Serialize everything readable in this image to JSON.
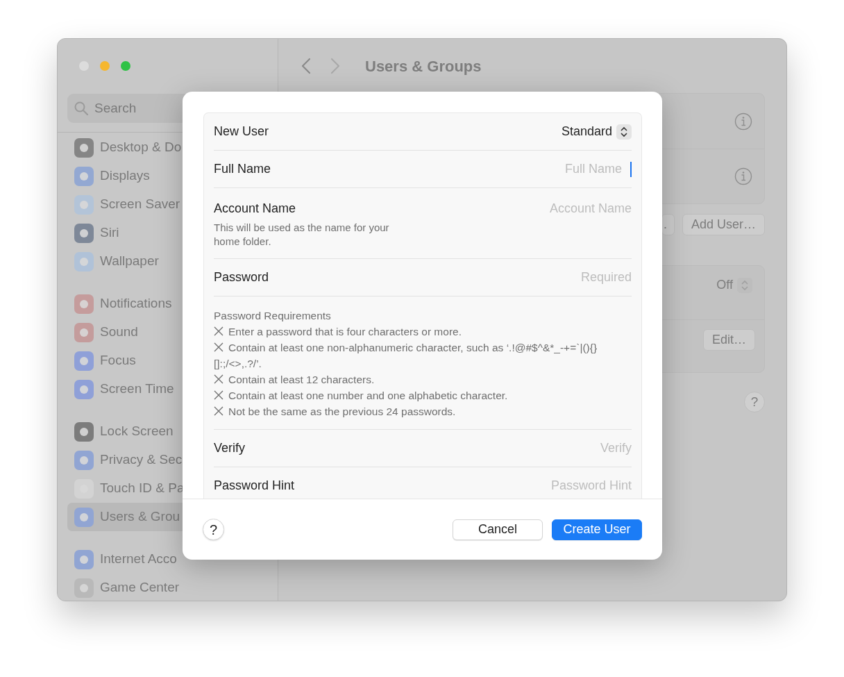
{
  "window": {
    "title": "Users & Groups",
    "controls": [
      {
        "color": "#dcdcdc"
      },
      {
        "color": "#f5b730"
      },
      {
        "color": "#2fc246"
      }
    ]
  },
  "sidebar": {
    "search": {
      "placeholder": "Search"
    },
    "groups": [
      {
        "items": [
          {
            "label": "Desktop & Do",
            "selected": false
          },
          {
            "label": "Displays",
            "selected": false
          },
          {
            "label": "Screen Saver",
            "selected": false
          },
          {
            "label": "Siri",
            "selected": false
          },
          {
            "label": "Wallpaper",
            "selected": false
          }
        ]
      },
      {
        "items": [
          {
            "label": "Notifications",
            "selected": false
          },
          {
            "label": "Sound",
            "selected": false
          },
          {
            "label": "Focus",
            "selected": false
          },
          {
            "label": "Screen Time",
            "selected": false
          }
        ]
      },
      {
        "items": [
          {
            "label": "Lock Screen",
            "selected": false
          },
          {
            "label": "Privacy & Sec",
            "selected": false
          },
          {
            "label": "Touch ID & Pa",
            "selected": false
          },
          {
            "label": "Users & Grou",
            "selected": true
          }
        ]
      },
      {
        "items": [
          {
            "label": "Internet Acco",
            "selected": false
          },
          {
            "label": "Game Center",
            "selected": false
          }
        ]
      }
    ]
  },
  "content": {
    "buttons": [
      ".",
      "Add User…"
    ],
    "setting_value": "Off",
    "edit_button": "Edit…",
    "help": "?"
  },
  "dialog": {
    "rows": [
      {
        "kind": "popup",
        "label": "New User",
        "value": "Standard"
      },
      {
        "kind": "field",
        "label": "Full Name",
        "placeholder": "Full Name",
        "focused": true
      },
      {
        "kind": "field",
        "label": "Account Name",
        "description": "This will be used as the name for your home folder.",
        "placeholder": "Account Name",
        "focused": false
      },
      {
        "kind": "field",
        "label": "Password",
        "placeholder": "Required",
        "focused": false
      },
      {
        "kind": "requirements",
        "title": "Password Requirements",
        "items": [
          {
            "text": "Enter a password that is four characters or more.",
            "met": false
          },
          {
            "text": "Contain at least one non-alphanumeric character, such as ‘.!@#$^&*_-+=`|(){}[]:;/<>,.?/’.",
            "met": false
          },
          {
            "text": "Contain at least 12 characters.",
            "met": false
          },
          {
            "text": "Contain at least one number and one alphabetic character.",
            "met": false
          },
          {
            "text": "Not be the same as the previous 24 passwords.",
            "met": false
          }
        ]
      },
      {
        "kind": "field",
        "label": "Verify",
        "placeholder": "Verify",
        "focused": false
      },
      {
        "kind": "field",
        "label": "Password Hint",
        "placeholder": "Password Hint",
        "focused": false
      }
    ],
    "help": "?",
    "buttons": [
      {
        "label": "Cancel",
        "primary": false
      },
      {
        "label": "Create User",
        "primary": true
      }
    ]
  }
}
